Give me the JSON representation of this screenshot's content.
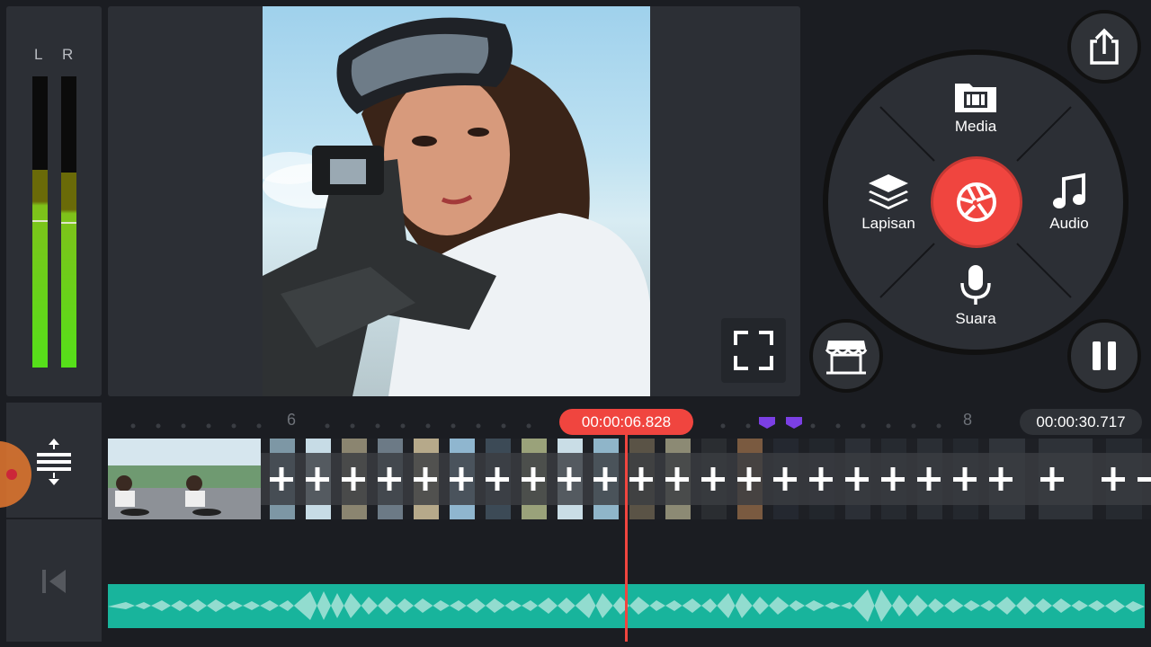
{
  "meters": {
    "left_label": "L",
    "right_label": "R",
    "left_level": 0.67,
    "right_level": 0.66
  },
  "preview": {
    "fullscreen_icon": "fullscreen-icon"
  },
  "radial_menu": {
    "media_label": "Media",
    "layer_label": "Lapisan",
    "audio_label": "Audio",
    "voice_label": "Suara",
    "record_icon": "camera-aperture-icon"
  },
  "buttons": {
    "share_icon": "share-icon",
    "store_icon": "store-icon",
    "pause_icon": "pause-icon"
  },
  "timeline": {
    "current_time": "00:00:06.828",
    "total_time": "00:00:30.717",
    "ruler_labels": [
      "6",
      "8"
    ],
    "marker_color": "#7b3fe4"
  },
  "colors": {
    "accent": "#f0453f",
    "audio_wave": "#18b49c"
  }
}
